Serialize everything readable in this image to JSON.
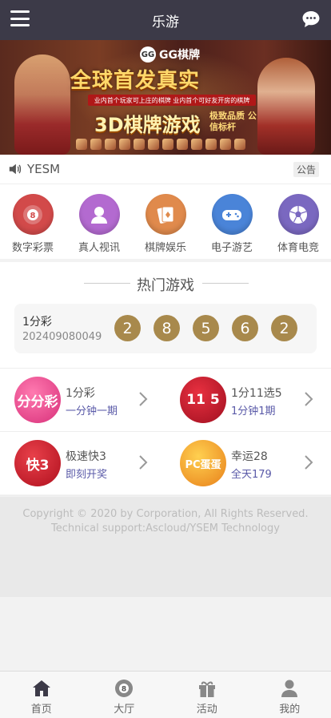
{
  "header": {
    "title": "乐游"
  },
  "banner": {
    "brand": "GG棋牌",
    "brand_logo": "GG",
    "headline": "全球首发真实",
    "subline": "业内首个玩家可上庄的棋牌  业内首个可好友开房的棋牌",
    "big_text": "3D棋牌游戏",
    "quality": "极致品质 公信标杆"
  },
  "notice": {
    "text": "YESM",
    "button_label": "公告"
  },
  "categories": [
    {
      "label": "数字彩票",
      "color": "#d24a4a",
      "icon": "lottery-ball-icon"
    },
    {
      "label": "真人视讯",
      "color": "#b36ad0",
      "icon": "person-icon"
    },
    {
      "label": "棋牌娱乐",
      "color": "#e08a4c",
      "icon": "cards-icon"
    },
    {
      "label": "电子游艺",
      "color": "#4a84d8",
      "icon": "gamepad-icon"
    },
    {
      "label": "体育电竞",
      "color": "#7a68c0",
      "icon": "soccer-ball-icon"
    }
  ],
  "hot": {
    "title": "热门游戏",
    "latest_draw": {
      "name": "1分彩",
      "issue": "202409080049",
      "numbers": [
        "2",
        "8",
        "5",
        "6",
        "2"
      ]
    },
    "games": [
      {
        "name": "1分彩",
        "desc": "一分钟一期",
        "icon_text": "分分彩",
        "color": "#e84a8a"
      },
      {
        "name": "1分11选5",
        "desc": "1分钟1期",
        "icon_text": "11 5",
        "color": "#c2182a"
      },
      {
        "name": "极速快3",
        "desc": "即刻开奖",
        "icon_text": "快3",
        "color": "#c21a2a"
      },
      {
        "name": "幸运28",
        "desc": "全天179",
        "icon_text": "PC蛋蛋",
        "color": "#f0a020"
      }
    ]
  },
  "footer": {
    "copyright": "Copyright © 2020 by Corporation, All Rights Reserved.",
    "support": "Technical support:Ascloud/YSEM Technology"
  },
  "nav": [
    {
      "label": "首页",
      "icon": "home-icon"
    },
    {
      "label": "大厅",
      "icon": "billiard-ball-icon"
    },
    {
      "label": "活动",
      "icon": "gift-icon"
    },
    {
      "label": "我的",
      "icon": "user-icon"
    }
  ]
}
